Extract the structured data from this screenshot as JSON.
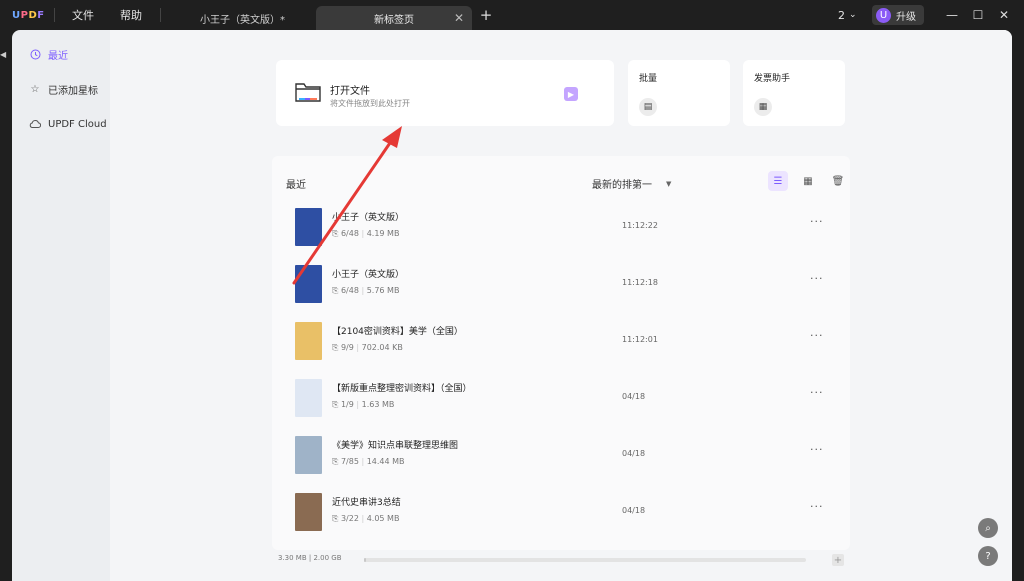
{
  "titlebar": {
    "logo": [
      "U",
      "P",
      "D",
      "F"
    ],
    "menu": {
      "file": "文件",
      "help": "帮助"
    },
    "tabs": [
      {
        "label": "小王子（英文版）*",
        "active": false
      },
      {
        "label": "新标签页",
        "active": true
      }
    ],
    "counter": "2",
    "upgrade": {
      "avatar": "U",
      "label": "升级"
    }
  },
  "sidebar": {
    "items": [
      {
        "label": "最近",
        "icon": "clock-icon",
        "active": true
      },
      {
        "label": "已添加星标",
        "icon": "star-icon",
        "active": false
      },
      {
        "label": "UPDF Cloud",
        "icon": "cloud-icon",
        "active": false
      }
    ]
  },
  "open_file": {
    "title": "打开文件",
    "subtitle": "将文件拖放到此处打开"
  },
  "batch": {
    "title": "批量"
  },
  "invoice": {
    "title": "发票助手"
  },
  "recent": {
    "title": "最近",
    "sort_label": "最新的排第一",
    "files": [
      {
        "name": "小王子（英文版）",
        "pages": "6/48",
        "size": "4.19 MB",
        "time": "11:12:22",
        "thumb": "#2e4fa3"
      },
      {
        "name": "小王子（英文版）",
        "pages": "6/48",
        "size": "5.76 MB",
        "time": "11:12:18",
        "thumb": "#2e4fa3"
      },
      {
        "name": "【2104密训资料】美学（全国）",
        "pages": "9/9",
        "size": "702.04 KB",
        "time": "11:12:01",
        "thumb": "#e9c067"
      },
      {
        "name": "【新版重点整理密训资料】（全国）",
        "pages": "1/9",
        "size": "1.63 MB",
        "time": "04/18",
        "thumb": "#dfe7f3"
      },
      {
        "name": "《美学》知识点串联整理思维图",
        "pages": "7/85",
        "size": "14.44 MB",
        "time": "04/18",
        "thumb": "#9fb3c8"
      },
      {
        "name": "近代史串讲3总结",
        "pages": "3/22",
        "size": "4.05 MB",
        "time": "04/18",
        "thumb": "#8a6b52"
      }
    ]
  },
  "storage": {
    "text": "3.30 MB | 2.00 GB",
    "fraction": 0.0016
  },
  "colors": {
    "accent": "#7c5cff",
    "annotation_arrow": "#e53935"
  }
}
